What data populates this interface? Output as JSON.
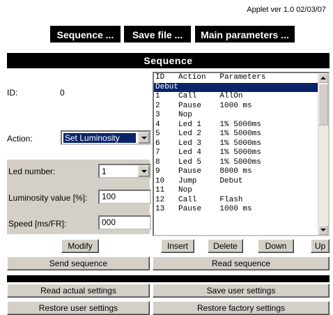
{
  "applet_version": "Applet ver 1.0 02/03/07",
  "top_buttons": {
    "sequence": "Sequence ...",
    "save_file": "Save file ...",
    "main_parameters": "Main parameters ..."
  },
  "section_title": "Sequence",
  "id": {
    "label": "ID:",
    "value": "0"
  },
  "action": {
    "label": "Action:",
    "selected": "Set Luminosity"
  },
  "led_number": {
    "label": "Led number:",
    "selected": "1"
  },
  "luminosity": {
    "label": "Luminosity value [%]:",
    "value": "100"
  },
  "speed": {
    "label": "Speed [ms/FR]:",
    "value": "000"
  },
  "sequence_list": {
    "header": "ID   Action   Parameters",
    "rows": [
      "Debut",
      "1    Call     AllOn",
      "2    Pause    1000 ms",
      "3    Nop",
      "4    Led 1    1% 5000ms",
      "5    Led 2    1% 5000ms",
      "6    Led 3    1% 5000ms",
      "7    Led 4    1% 5000ms",
      "8    Led 5    1% 5000ms",
      "9    Pause    8000 ms",
      "10   Jump     Debut",
      "11   Nop",
      "12   Call     Flash",
      "13   Pause    1000 ms"
    ],
    "selected_index": 0
  },
  "buttons": {
    "modify": "Modify",
    "insert": "Insert",
    "delete": "Delete",
    "down": "Down",
    "up": "Up",
    "send_sequence": "Send sequence",
    "read_sequence": "Read sequence",
    "read_actual_settings": "Read actual settings",
    "save_user_settings": "Save user settings",
    "restore_user_settings": "Restore user settings",
    "restore_factory_settings": "Restore factory settings"
  }
}
